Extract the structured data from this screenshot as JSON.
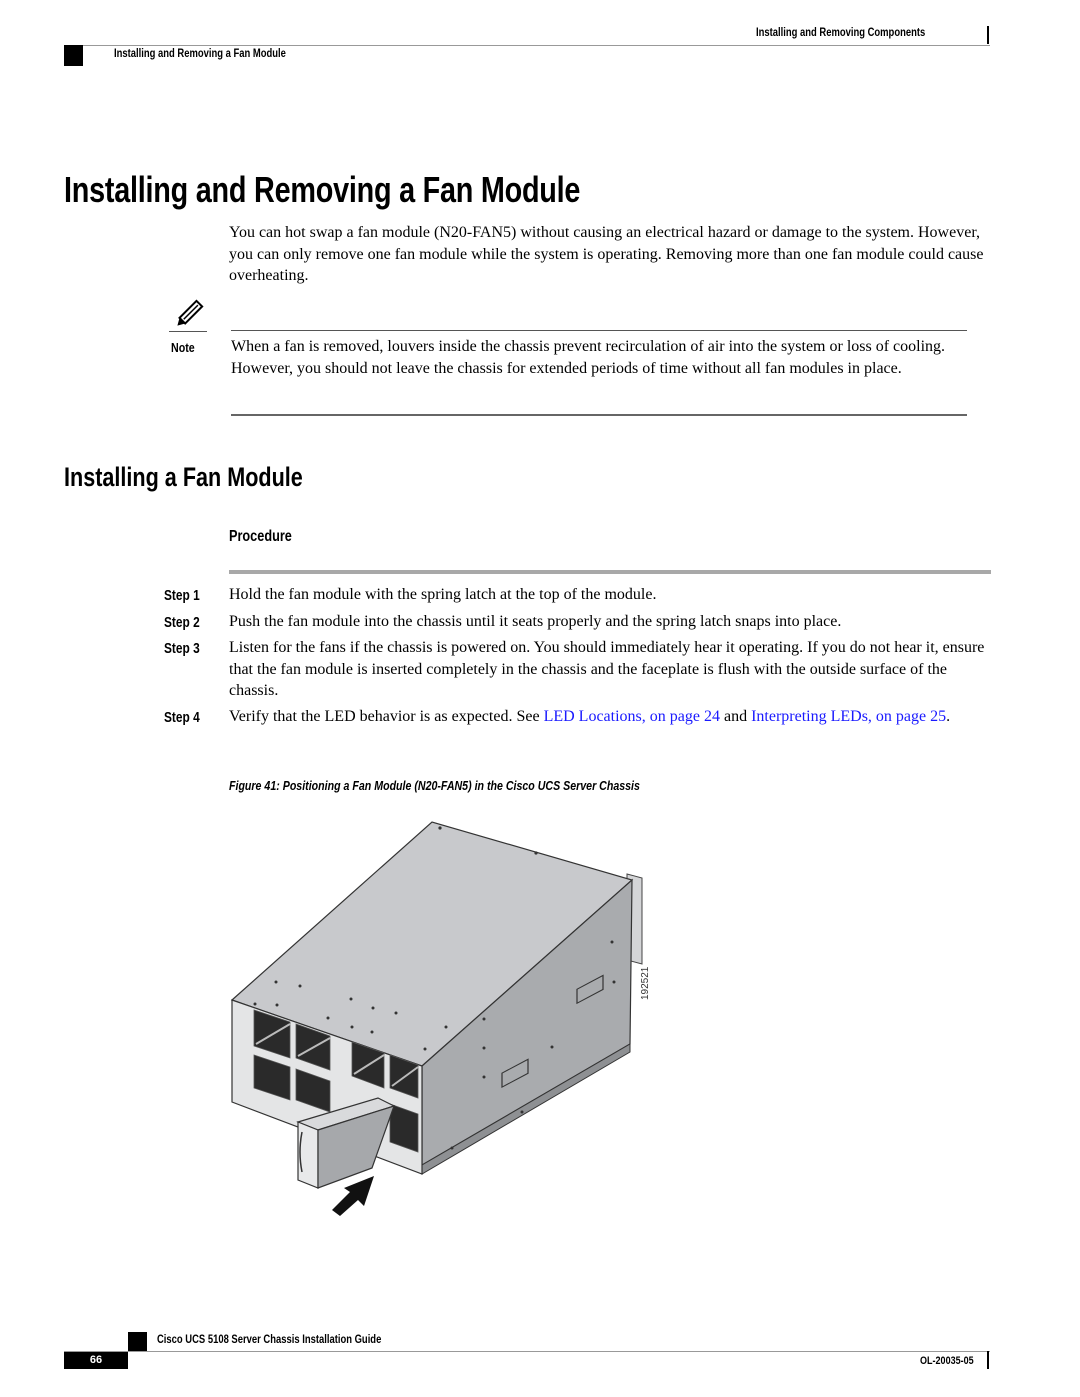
{
  "header": {
    "chapter": "Installing and Removing Components",
    "section": "Installing and Removing a Fan Module"
  },
  "main": {
    "title": "Installing and Removing a Fan Module",
    "intro": "You can hot swap a fan module (N20-FAN5) without causing an electrical hazard or damage to the system. However, you can only remove one fan module while the system is operating. Removing more than one fan module could cause overheating.",
    "note": {
      "icon": "pencil-note-icon",
      "label": "Note",
      "text": "When a fan is removed, louvers inside the chassis prevent recirculation of air into the system or loss of cooling. However, you should not leave the chassis for extended periods of time without all fan modules in place."
    },
    "subsection_title": "Installing a Fan Module",
    "procedure_label": "Procedure",
    "steps": [
      {
        "label": "Step 1",
        "text": "Hold the fan module with the spring latch at the top of the module."
      },
      {
        "label": "Step 2",
        "text": "Push the fan module into the chassis until it seats properly and the spring latch snaps into place."
      },
      {
        "label": "Step 3",
        "text": "Listen for the fans if the chassis is powered on. You should immediately hear it operating. If you do not hear it, ensure that the fan module is inserted completely in the chassis and the faceplate is flush with the outside surface of the chassis."
      },
      {
        "label": "Step 4",
        "text_before": "Verify that the LED behavior is as expected. See ",
        "link1": "LED Locations,  on page 24",
        "text_mid": " and ",
        "link2": "Interpreting LEDs,  on page 25",
        "text_after": "."
      }
    ],
    "figure": {
      "caption": "Figure 41: Positioning a Fan Module (N20-FAN5) in the Cisco UCS Server Chassis",
      "id": "192521"
    }
  },
  "footer": {
    "guide_title": "Cisco UCS 5108 Server Chassis Installation Guide",
    "page_number": "66",
    "doc_number": "OL-20035-05"
  },
  "colors": {
    "link": "#1a1aff",
    "chassis_top": "#c8c9cc",
    "chassis_side": "#a9abae"
  }
}
